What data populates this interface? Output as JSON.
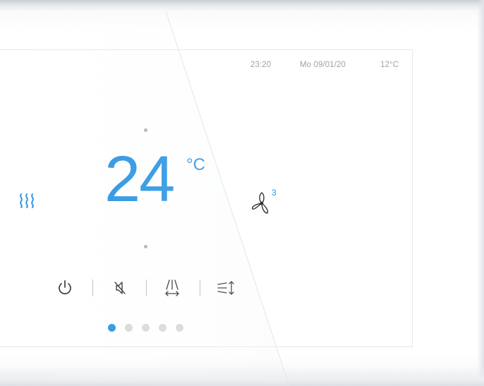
{
  "status_bar": {
    "time": "23:20",
    "date": "Mo 09/01/20",
    "outdoor_temperature": "12°C"
  },
  "thermostat": {
    "mode_icon": "heating-icon",
    "setpoint": "24",
    "unit": "°C",
    "fan_icon": "fan-icon",
    "fan_speed": "3",
    "increase_indicator": "dot",
    "decrease_indicator": "dot"
  },
  "controls": [
    {
      "name": "power",
      "icon": "power-icon"
    },
    {
      "name": "mute",
      "icon": "speaker-off-icon"
    },
    {
      "name": "vertical-swing",
      "icon": "vertical-swing-icon"
    },
    {
      "name": "horizontal-swing",
      "icon": "horizontal-swing-icon"
    }
  ],
  "pagination": {
    "pages": 5,
    "active_page": 1
  },
  "colors": {
    "accent": "#2b95e1",
    "text_muted": "#9ea3a9",
    "icon_dark": "#2f3337",
    "dot_inactive": "#d7d9dd"
  }
}
